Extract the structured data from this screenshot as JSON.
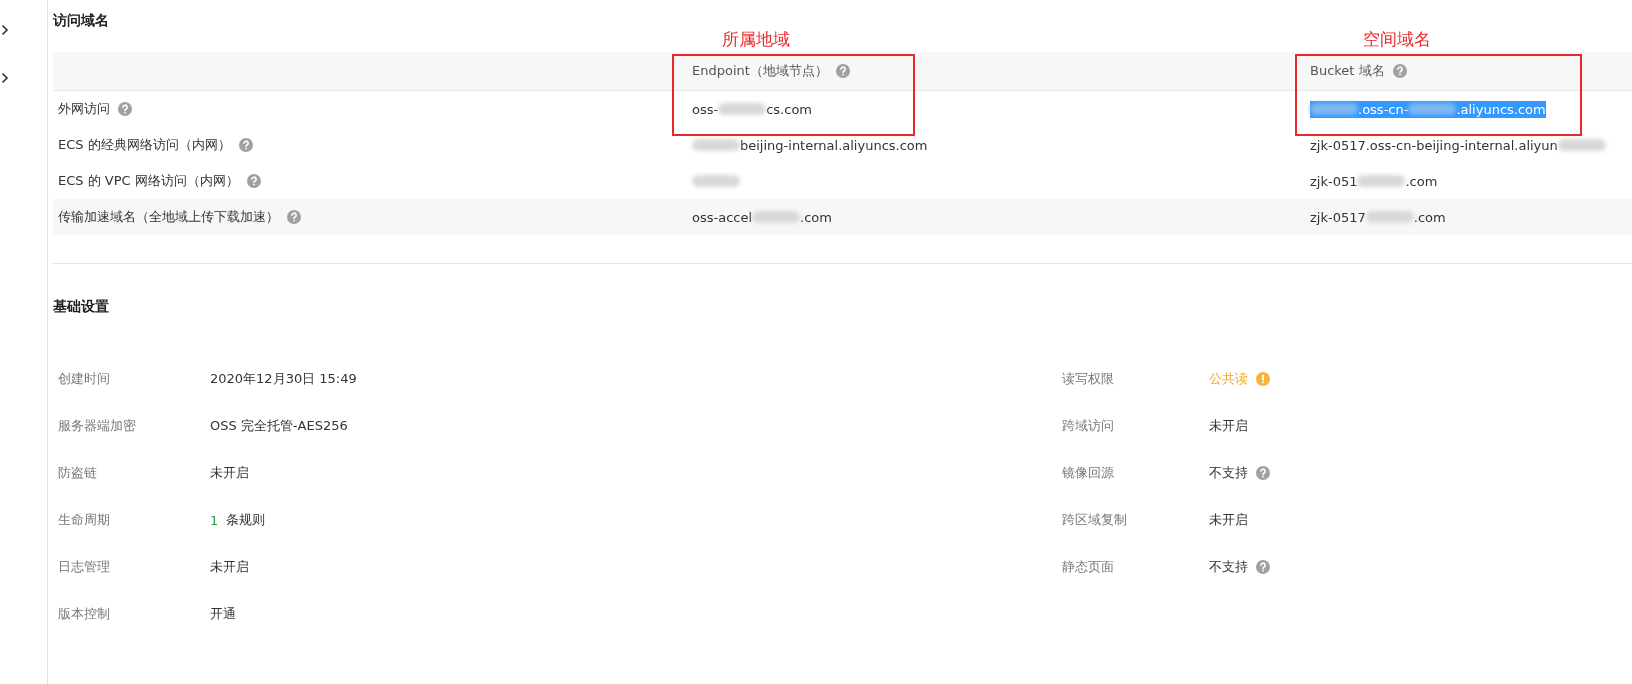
{
  "domain_section": {
    "title": "访问域名",
    "columns": [
      {
        "label": "Endpoint（地域节点）",
        "help": true,
        "annotation": "所属地域"
      },
      {
        "label": "Bucket 域名",
        "help": true,
        "annotation": "空间域名"
      }
    ],
    "rows": [
      {
        "label": "外网访问",
        "help": true,
        "cells": [
          {
            "selected": false,
            "parts": [
              {
                "kind": "text",
                "text": "oss-"
              },
              {
                "kind": "blur"
              },
              {
                "kind": "text",
                "text": "cs.com"
              }
            ]
          },
          {
            "selected": true,
            "parts": [
              {
                "kind": "blur"
              },
              {
                "kind": "text",
                "text": ".oss-cn-"
              },
              {
                "kind": "blur"
              },
              {
                "kind": "text",
                "text": ".aliyuncs.com"
              }
            ]
          }
        ]
      },
      {
        "label": "ECS 的经典网络访问（内网）",
        "help": true,
        "cells": [
          {
            "selected": false,
            "parts": [
              {
                "kind": "blur"
              },
              {
                "kind": "text",
                "text": "beijing-internal.aliyuncs.com"
              }
            ]
          },
          {
            "selected": false,
            "parts": [
              {
                "kind": "text",
                "text": "zjk-0517.oss-cn-beijing-internal.aliyun"
              },
              {
                "kind": "blur"
              }
            ]
          }
        ]
      },
      {
        "label": "ECS 的 VPC 网络访问（内网）",
        "help": true,
        "cells": [
          {
            "selected": false,
            "parts": [
              {
                "kind": "blur"
              }
            ]
          },
          {
            "selected": false,
            "parts": [
              {
                "kind": "text",
                "text": "zjk-051"
              },
              {
                "kind": "blur"
              },
              {
                "kind": "text",
                "text": ".com"
              }
            ]
          }
        ]
      },
      {
        "label": "传输加速域名（全地域上传下载加速）",
        "help": true,
        "cells": [
          {
            "selected": false,
            "parts": [
              {
                "kind": "text",
                "text": "oss-accel"
              },
              {
                "kind": "blur"
              },
              {
                "kind": "text",
                "text": ".com"
              }
            ]
          },
          {
            "selected": false,
            "parts": [
              {
                "kind": "text",
                "text": "zjk-0517"
              },
              {
                "kind": "blur"
              },
              {
                "kind": "text",
                "text": ".com"
              }
            ]
          }
        ]
      }
    ],
    "kind": "table"
  },
  "basic_section": {
    "title": "基础设置",
    "left": [
      {
        "label": "创建时间",
        "value": "2020年12月30日 15:49"
      },
      {
        "label": "服务器端加密",
        "value": "OSS 完全托管-AES256"
      },
      {
        "label": "防盗链",
        "value": "未开启"
      },
      {
        "label": "生命周期",
        "count": "1",
        "value": "条规则"
      },
      {
        "label": "日志管理",
        "value": "未开启"
      },
      {
        "label": "版本控制",
        "value": "开通"
      }
    ],
    "right": [
      {
        "label": "读写权限",
        "value": "公共读",
        "kind": "warning"
      },
      {
        "label": "跨域访问",
        "value": "未开启",
        "kind": "plain"
      },
      {
        "label": "镜像回源",
        "value": "不支持",
        "kind": "plain",
        "help": true
      },
      {
        "label": "跨区域复制",
        "value": "未开启",
        "kind": "plain"
      },
      {
        "label": "静态页面",
        "value": "不支持",
        "kind": "plain",
        "help": true
      }
    ]
  }
}
